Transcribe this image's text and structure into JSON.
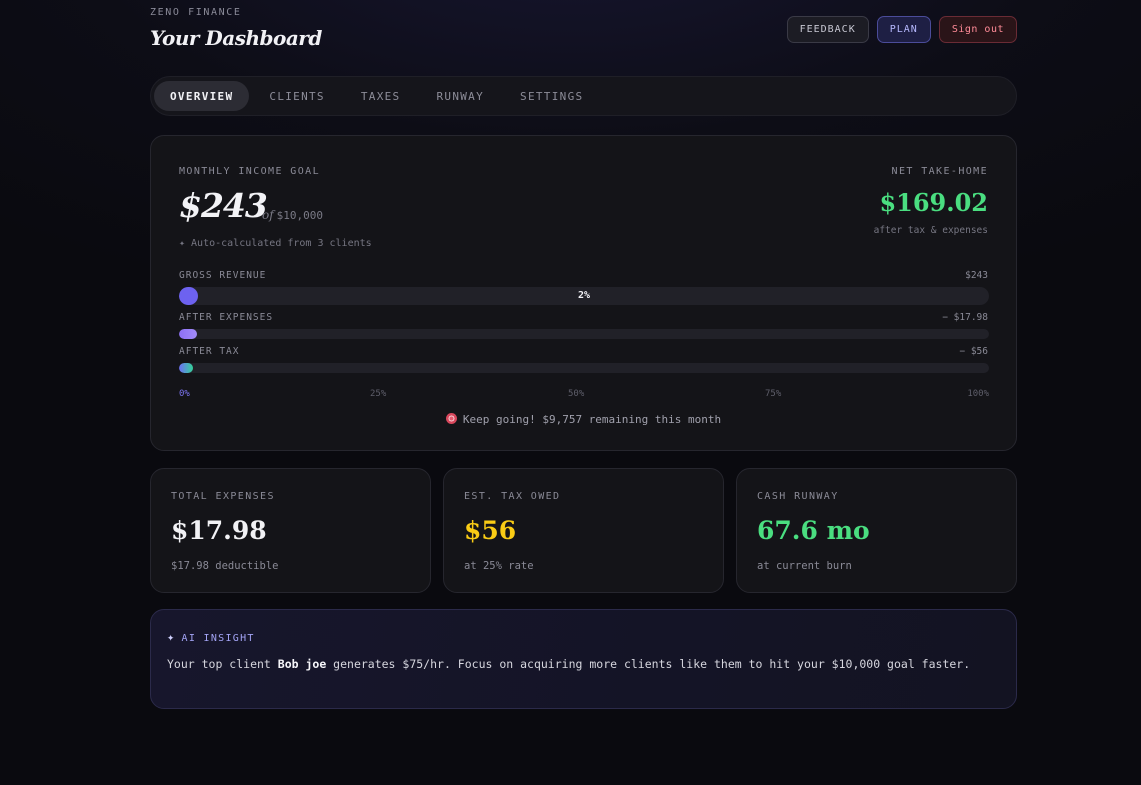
{
  "header": {
    "brand": "ZENO FINANCE",
    "title": "Your Dashboard",
    "feedback_label": "FEEDBACK",
    "plan_label": "PLAN",
    "signout_label": "Sign out"
  },
  "tabs": [
    {
      "label": "OVERVIEW",
      "active": true
    },
    {
      "label": "CLIENTS",
      "active": false
    },
    {
      "label": "TAXES",
      "active": false
    },
    {
      "label": "RUNWAY",
      "active": false
    },
    {
      "label": "SETTINGS",
      "active": false
    }
  ],
  "goal": {
    "label": "MONTHLY INCOME GOAL",
    "amount": "$243",
    "of_word": "of",
    "target": "$10,000",
    "note": "✦ Auto-calculated from 3 clients",
    "net_label": "NET TAKE-HOME",
    "net_amount": "$169.02",
    "net_sub": "after tax & expenses"
  },
  "bars": {
    "gross": {
      "label": "GROSS REVENUE",
      "value": "$243",
      "percent_text": "2%",
      "fill_fraction": 0.024
    },
    "expenses": {
      "label": "AFTER EXPENSES",
      "value": "− $17.98",
      "fill_fraction": 0.022
    },
    "tax": {
      "label": "AFTER TAX",
      "value": "− $56",
      "fill_fraction": 0.017
    },
    "ticks": [
      "0%",
      "25%",
      "50%",
      "75%",
      "100%"
    ]
  },
  "keep_going": "Keep going! $9,757 remaining this month",
  "stats": {
    "expenses": {
      "label": "TOTAL EXPENSES",
      "value": "$17.98",
      "sub": "$17.98 deductible",
      "color": "#f2f2f5"
    },
    "tax": {
      "label": "EST. TAX OWED",
      "value": "$56",
      "sub": "at 25% rate",
      "color": "#facc15"
    },
    "runway": {
      "label": "CASH RUNWAY",
      "value": "67.6 mo",
      "sub": "at current burn",
      "color": "#4ade80"
    }
  },
  "insight": {
    "label": "AI INSIGHT",
    "text_before": "Your top client ",
    "client_name": "Bob joe",
    "text_after": " generates $75/hr. Focus on acquiring more clients like them to hit your $10,000 goal faster."
  },
  "colors": {
    "accent": "#6d62f0",
    "positive": "#4ade80",
    "warning": "#facc15",
    "danger": "#ff8b98"
  }
}
